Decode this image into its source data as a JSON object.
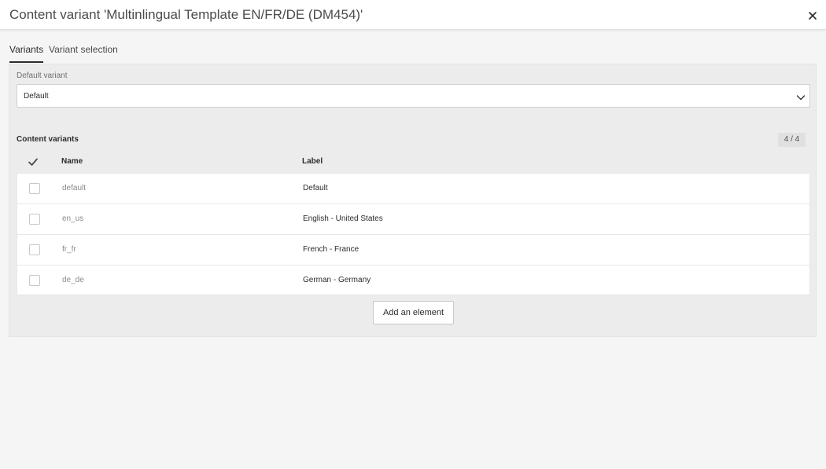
{
  "window": {
    "title": "Content variant 'Multinlingual Template EN/FR/DE (DM454)'",
    "close_icon": "close-icon"
  },
  "tabs": [
    {
      "label": "Variants",
      "active": true
    },
    {
      "label": "Variant selection",
      "active": false
    }
  ],
  "default_variant": {
    "label": "Default variant",
    "value": "Default"
  },
  "content_variants": {
    "title": "Content variants",
    "count": "4 / 4",
    "columns": {
      "name": "Name",
      "label": "Label"
    },
    "rows": [
      {
        "name": "default",
        "label": "Default"
      },
      {
        "name": "en_us",
        "label": "English - United States"
      },
      {
        "name": "fr_fr",
        "label": "French - France"
      },
      {
        "name": "de_de",
        "label": "German - Germany"
      }
    ],
    "add_button": "Add an element"
  },
  "colors": {
    "background": "#f5f5f5",
    "panel": "#ececec",
    "text": "#2c2c2c"
  }
}
